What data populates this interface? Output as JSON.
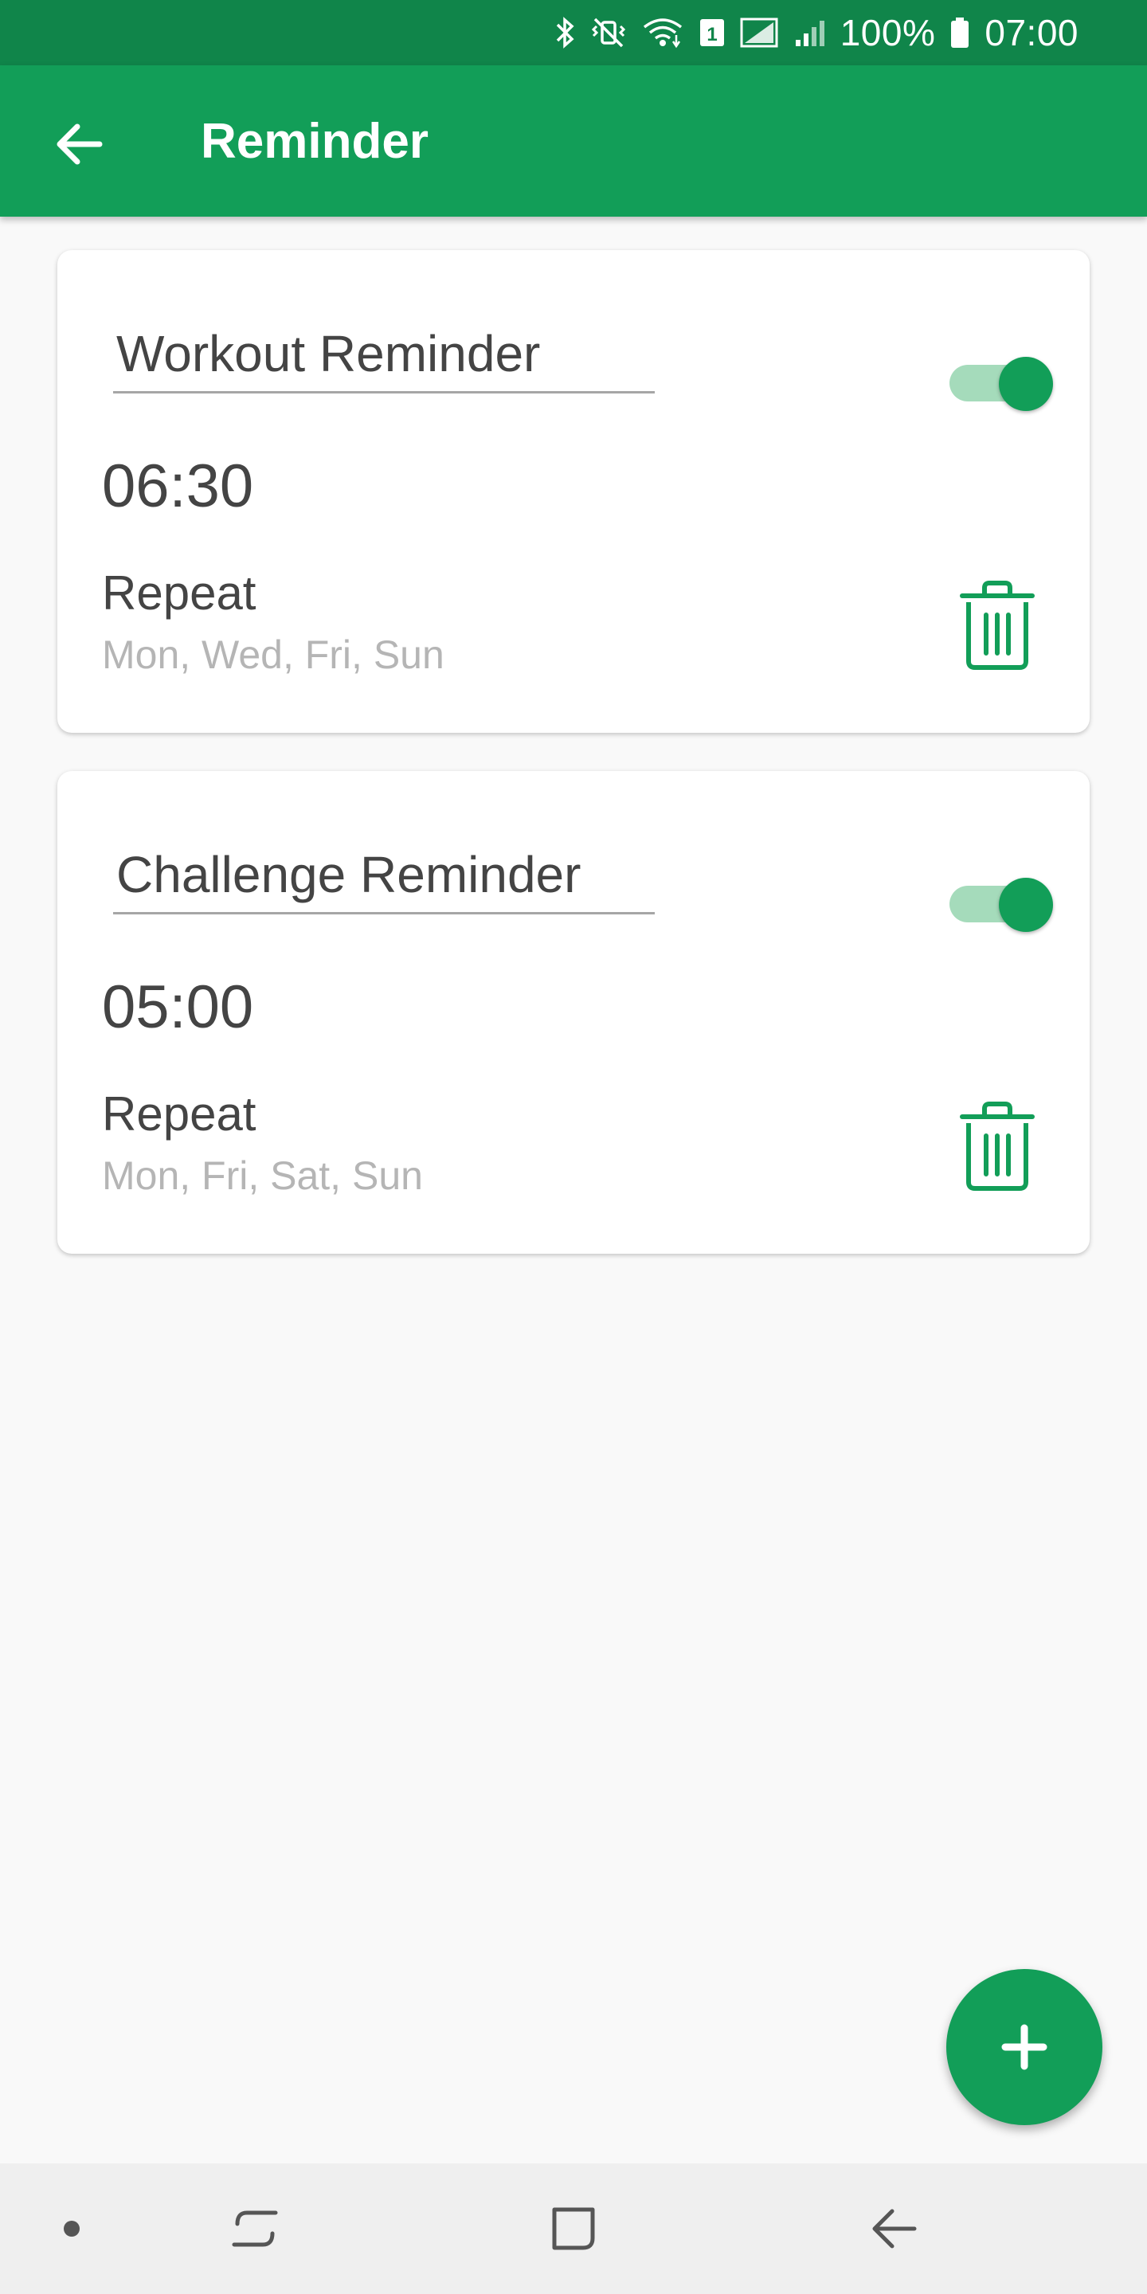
{
  "status_bar": {
    "battery_percent": "100%",
    "time": "07:00",
    "icons": [
      "bluetooth-icon",
      "vibrate-mute-icon",
      "wifi-icon",
      "sim-1-icon",
      "signal-icon",
      "signal-icon",
      "battery-icon"
    ]
  },
  "toolbar": {
    "title": "Reminder",
    "back_icon": "arrow-left-icon"
  },
  "reminders": [
    {
      "name": "Workout Reminder",
      "enabled": true,
      "time": "06:30",
      "repeat_label": "Repeat",
      "repeat_days": "Mon, Wed, Fri, Sun",
      "delete_icon": "trash-icon"
    },
    {
      "name": "Challenge Reminder",
      "enabled": true,
      "time": "05:00",
      "repeat_label": "Repeat",
      "repeat_days": "Mon, Fri, Sat, Sun",
      "delete_icon": "trash-icon"
    }
  ],
  "fab": {
    "icon": "plus-icon"
  },
  "nav_bar": {
    "buttons": [
      "dot-icon",
      "recents-icon",
      "home-icon",
      "back-icon"
    ]
  },
  "colors": {
    "status_bar": "#10854a",
    "primary": "#129e58",
    "toggle_track": "#a5dbbb",
    "background": "#f9f9f9"
  }
}
